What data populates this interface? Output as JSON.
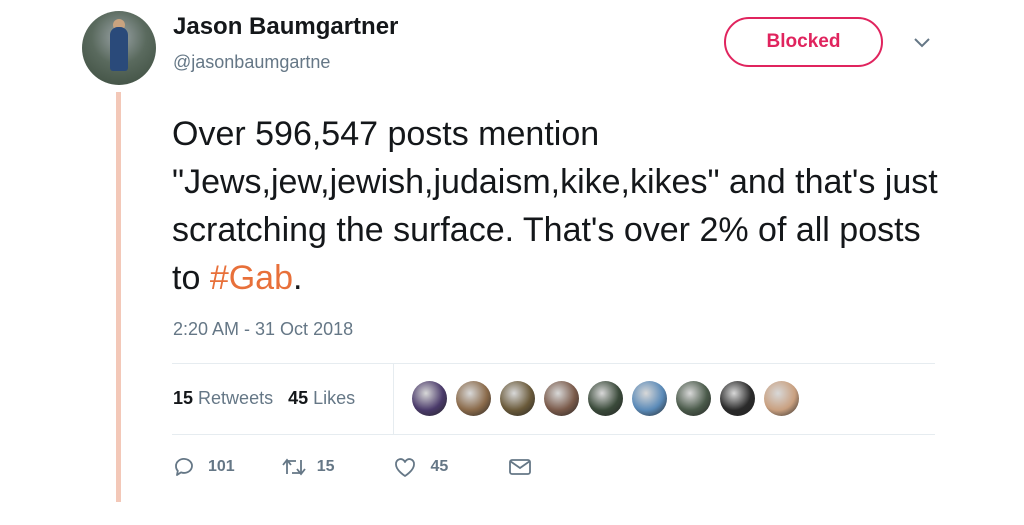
{
  "tweet": {
    "author_name": "Jason Baumgartner",
    "author_handle": "@jasonbaumgartne",
    "follow_state_label": "Blocked",
    "text_before_hashtag": "Over 596,547 posts mention \"Jews,jew,jewish,judaism,kike,kikes\" and that's just scratching the surface. That's over 2% of all posts to ",
    "hashtag": "#Gab",
    "text_after_hashtag": ".",
    "timestamp": "2:20 AM - 31 Oct 2018",
    "retweets_count": "15",
    "retweets_label": "Retweets",
    "likes_count": "45",
    "likes_label": "Likes",
    "liker_avatar_colors": [
      "#4a3a6a",
      "#8a6a4a",
      "#6a5a3a",
      "#7a5a4a",
      "#3a4a3a",
      "#5a8ab8",
      "#4a5a4a",
      "#2a2a2a",
      "#c9a080"
    ],
    "actions": {
      "replies_count": "101",
      "retweets_count": "15",
      "likes_count": "45"
    }
  },
  "colors": {
    "blocked_accent": "#e0245e",
    "hashtag": "#e8703a",
    "thread_line": "#f3c8b8",
    "secondary_text": "#657786"
  },
  "icons": [
    "chevron-down-icon",
    "reply-icon",
    "retweet-icon",
    "heart-icon",
    "direct-message-icon"
  ]
}
